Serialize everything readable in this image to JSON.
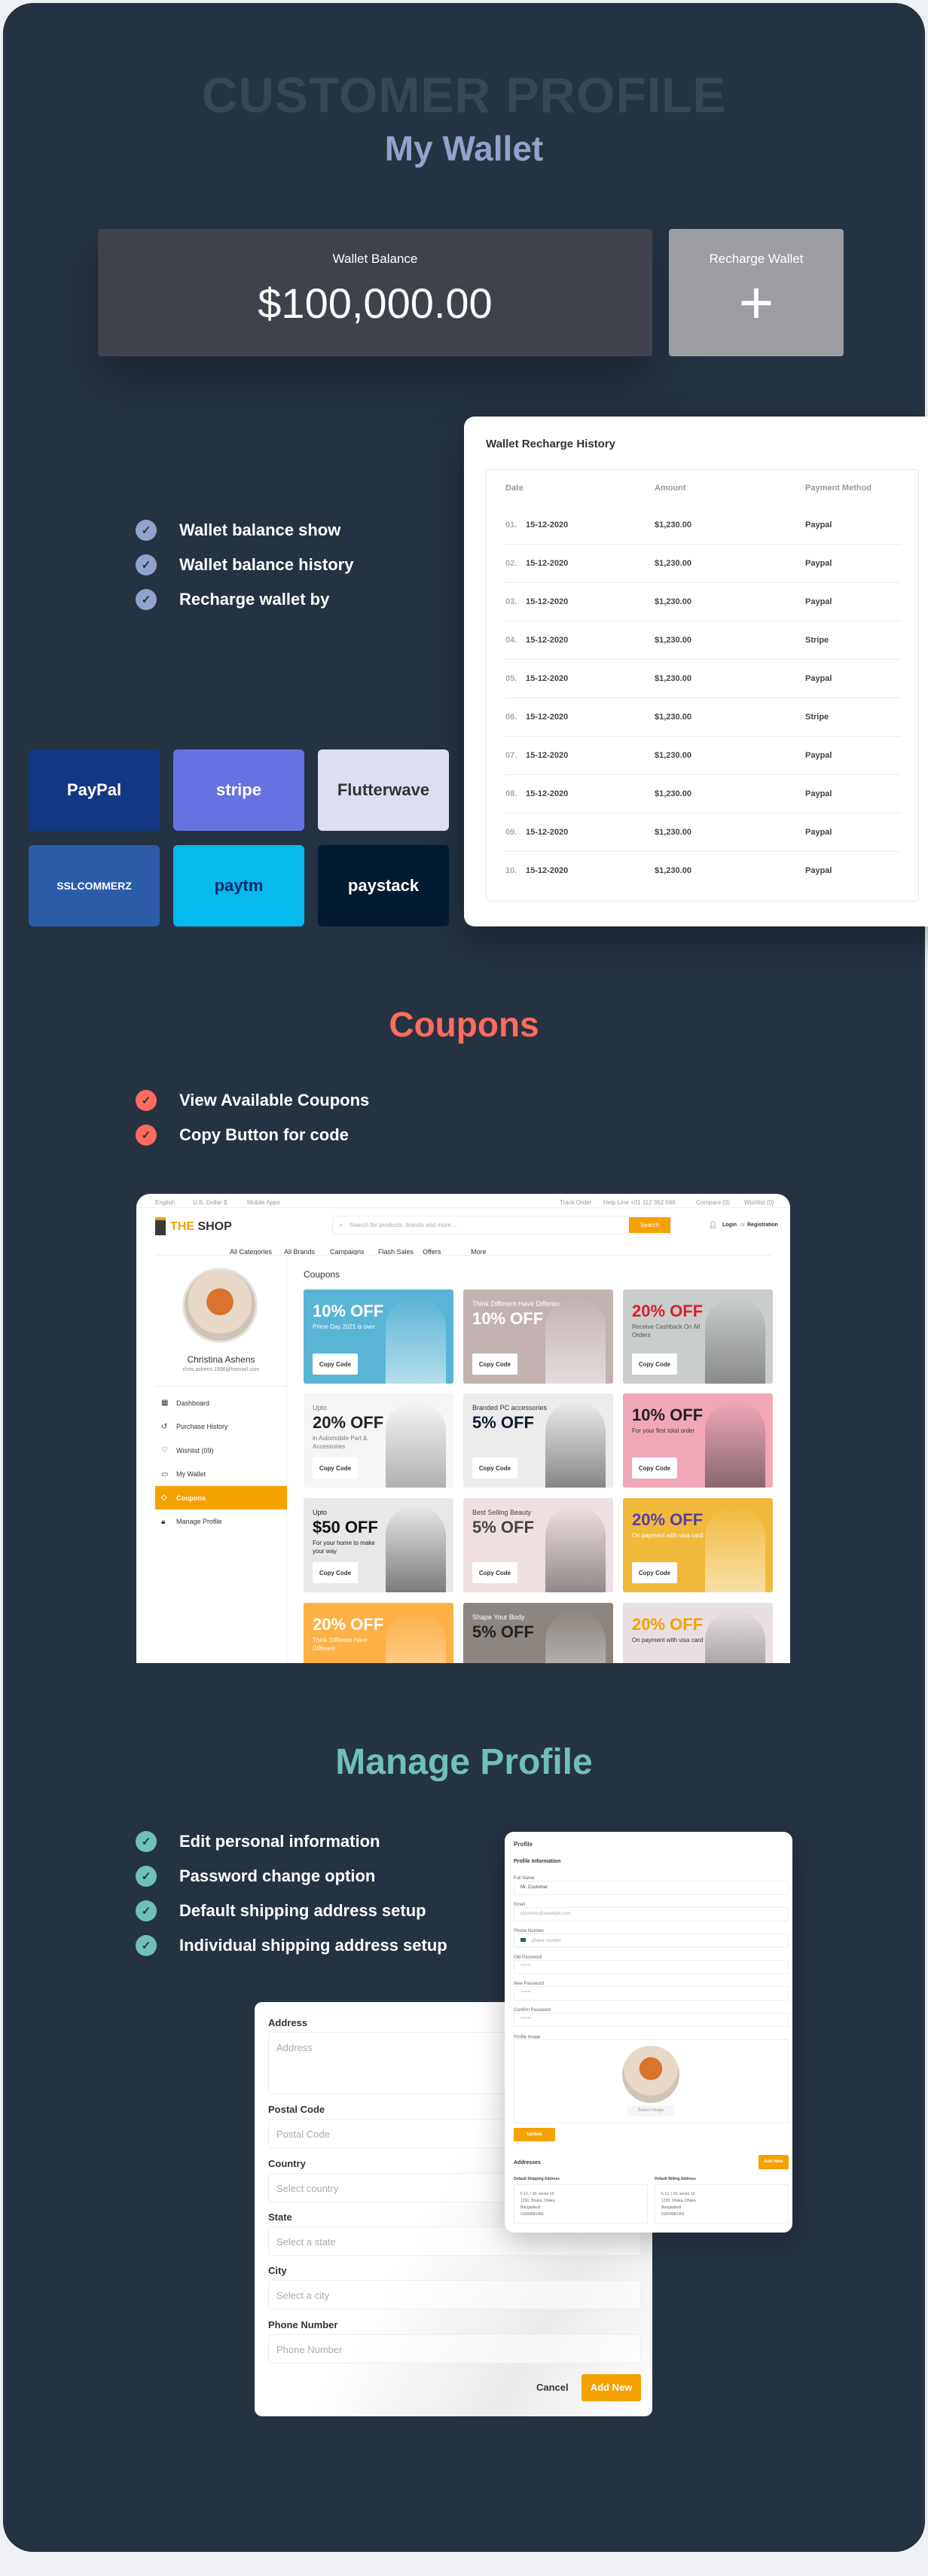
{
  "hero": {
    "title": "CUSTOMER PROFILE",
    "wallet_heading": "My Wallet",
    "coupons_heading": "Coupons",
    "profile_heading": "Manage Profile"
  },
  "colors": {
    "background": "#253241",
    "wallet_accent": "#8fa3cc",
    "coupons_accent": "#ff6b5e",
    "profile_accent": "#6fc0b8",
    "shop_orange": "#f5a100"
  },
  "wallet": {
    "balance_label": "Wallet Balance",
    "balance": "$100,000.00",
    "recharge_label": "Recharge Wallet",
    "recharge_icon": "plus-icon"
  },
  "wallet_features": [
    "Wallet balance show",
    "Wallet balance history",
    "Recharge wallet by"
  ],
  "payment_logos": [
    {
      "name": "PayPal",
      "bg": "#143783",
      "fg": "#ffffff"
    },
    {
      "name": "stripe",
      "bg": "#6772e2",
      "fg": "#ffffff"
    },
    {
      "name": "Flutterwave",
      "bg": "#dcdff2",
      "fg": "#333333"
    },
    {
      "name": "SSLCOMMERZ",
      "bg": "#2c5ba8",
      "fg": "#ffffff"
    },
    {
      "name": "paytm",
      "bg": "#05baee",
      "fg": "#0d2a6b"
    },
    {
      "name": "paystack",
      "bg": "#011b33",
      "fg": "#ffffff"
    }
  ],
  "history": {
    "title": "Wallet Recharge History",
    "headers": [
      "Date",
      "Amount",
      "Payment Method"
    ],
    "rows": [
      {
        "no": "01.",
        "date": "15-12-2020",
        "amount": "$1,230.00",
        "method": "Paypal"
      },
      {
        "no": "02.",
        "date": "15-12-2020",
        "amount": "$1,230.00",
        "method": "Paypal"
      },
      {
        "no": "03.",
        "date": "15-12-2020",
        "amount": "$1,230.00",
        "method": "Paypal"
      },
      {
        "no": "04.",
        "date": "15-12-2020",
        "amount": "$1,230.00",
        "method": "Stripe"
      },
      {
        "no": "05.",
        "date": "15-12-2020",
        "amount": "$1,230.00",
        "method": "Paypal"
      },
      {
        "no": "06.",
        "date": "15-12-2020",
        "amount": "$1,230.00",
        "method": "Stripe"
      },
      {
        "no": "07.",
        "date": "15-12-2020",
        "amount": "$1,230.00",
        "method": "Paypal"
      },
      {
        "no": "08.",
        "date": "15-12-2020",
        "amount": "$1,230.00",
        "method": "Paypal"
      },
      {
        "no": "09.",
        "date": "15-12-2020",
        "amount": "$1,230.00",
        "method": "Paypal"
      },
      {
        "no": "10.",
        "date": "15-12-2020",
        "amount": "$1,230.00",
        "method": "Paypal"
      }
    ]
  },
  "coupon_features": [
    "View Available Coupons",
    "Copy Button for code"
  ],
  "shop": {
    "topbar": {
      "language": "English",
      "currency": "U.S. Dollar $",
      "mobile_apps": "Mobile Apps",
      "track_order": "Track Order",
      "helpline": "Help Line +01 112 352 566",
      "compare": "Compare (0)",
      "wishlist": "Wishlist (0)"
    },
    "logo_the": "THE",
    "logo_shop": "SHOP",
    "search_placeholder": "Search for products, brands and more ...",
    "search_button": "Search",
    "login": "Login",
    "or": "or",
    "registration": "Registration",
    "nav": [
      "All Categories",
      "All Brands",
      "Campaigns",
      "Flash Sales",
      "Offers",
      "More"
    ],
    "user": {
      "name": "Christina Ashens",
      "email": "chris.ashens.1996@hotmail.com"
    },
    "menu": [
      {
        "label": "Dashboard",
        "icon": "grid-icon",
        "active": false
      },
      {
        "label": "Purchase History",
        "icon": "history-icon",
        "active": false
      },
      {
        "label": "Wishlist (09)",
        "icon": "heart-icon",
        "active": false
      },
      {
        "label": "My Wallet",
        "icon": "wallet-icon",
        "active": false
      },
      {
        "label": "Coupons",
        "icon": "ticket-icon",
        "active": true
      },
      {
        "label": "Manage Profile",
        "icon": "lock-icon",
        "active": false
      }
    ],
    "page_title": "Coupons",
    "copy_label": "Copy Code",
    "coupons": [
      {
        "pre": "",
        "big": "10% OFF",
        "sub": "Prime Day 2021 is over",
        "bg": "#5ab5d5",
        "fg": "#ffffff",
        "big_color": "#ffffff",
        "button": true
      },
      {
        "pre": "Think Different Have Differen",
        "big": "10% OFF",
        "sub": "",
        "bg": "#c2b3b2",
        "fg": "#ffffff",
        "big_color": "#ffffff",
        "button": true
      },
      {
        "pre": "",
        "big": "20% OFF",
        "sub": "Receive Cashback On All Orders",
        "bg": "#c9cdcb",
        "fg": "#555555",
        "big_color": "#d81e2b",
        "button": true
      },
      {
        "pre": "Upto",
        "big": "20% OFF",
        "sub": "in Automobile Part & Accessories",
        "bg": "#f6f6f6",
        "fg": "#777777",
        "big_color": "#222222",
        "button": true
      },
      {
        "pre": "Branded PC accessories",
        "big": "5% OFF",
        "sub": "",
        "bg": "#ececec",
        "fg": "#333333",
        "big_color": "#111a2e",
        "button": true
      },
      {
        "pre": "",
        "big": "10% OFF",
        "sub": "For your first total order",
        "bg": "#f0a8b9",
        "fg": "#333333",
        "big_color": "#222222",
        "button": true
      },
      {
        "pre": "Upto",
        "big": "$50 OFF",
        "sub": "For your home to make your way",
        "bg": "#e8e8ea",
        "fg": "#222222",
        "big_color": "#111111",
        "button": true
      },
      {
        "pre": "Best Selling Beauty",
        "big": "5% OFF",
        "sub": "",
        "bg": "#eedfe0",
        "fg": "#444444",
        "big_color": "#444444",
        "button": true
      },
      {
        "pre": "",
        "big": "20% OFF",
        "sub": "On payment with visa card",
        "bg": "#f1b93c",
        "fg": "#ffffff",
        "big_color": "#5b3ea8",
        "button": true
      },
      {
        "pre": "",
        "big": "20% OFF",
        "sub": "Think Different Have Different",
        "bg": "#fdb044",
        "fg": "#ffffff",
        "big_color": "#ffffff",
        "button": false
      },
      {
        "pre": "Shape Your Body",
        "big": "5% OFF",
        "sub": "",
        "bg": "#8c8580",
        "fg": "#ffffff",
        "big_color": "#222222",
        "button": false
      },
      {
        "pre": "",
        "big": "20% OFF",
        "sub": "On payment with visa card",
        "bg": "#e7dfe2",
        "fg": "#333333",
        "big_color": "#f5a100",
        "button": false
      }
    ]
  },
  "profile_features": [
    "Edit personal information",
    "Password change option",
    "Default shipping address setup",
    "Individual shipping address setup"
  ],
  "profile": {
    "title": "Profile",
    "section": "Profile Information",
    "fields": [
      {
        "label": "Full Name",
        "value": "Mr. Customer"
      },
      {
        "label": "Email",
        "value": "customer@example.com"
      },
      {
        "label": "Phone Number",
        "value": "phone number"
      },
      {
        "label": "Old Password",
        "value": "******"
      },
      {
        "label": "New Password",
        "value": "******"
      },
      {
        "label": "Confirm Password",
        "value": "******"
      }
    ],
    "image_label": "Profile Image",
    "select_image": "Select Image",
    "update": "Update",
    "addresses": "Addresses",
    "add_new": "Add New",
    "shipping_label": "Default Shipping Address",
    "billing_label": "Default Billing Address",
    "shipping": [
      "h 12, r 10, sector 10",
      "1230, Dhaka, Dhaka",
      "Bangladesh",
      "01564981465"
    ],
    "billing": [
      "h 12, r 10, sector 10",
      "1230, Dhaka, Dhaka",
      "Bangladesh",
      "01564981465"
    ]
  },
  "address_form": {
    "fields": [
      {
        "label": "Address",
        "placeholder": "Address"
      },
      {
        "label": "Postal Code",
        "placeholder": "Postal Code"
      },
      {
        "label": "Country",
        "placeholder": "Select country"
      },
      {
        "label": "State",
        "placeholder": "Select a state"
      },
      {
        "label": "City",
        "placeholder": "Select a city"
      },
      {
        "label": "Phone Number",
        "placeholder": "Phone Number"
      }
    ],
    "cancel": "Cancel",
    "submit": "Add New"
  }
}
